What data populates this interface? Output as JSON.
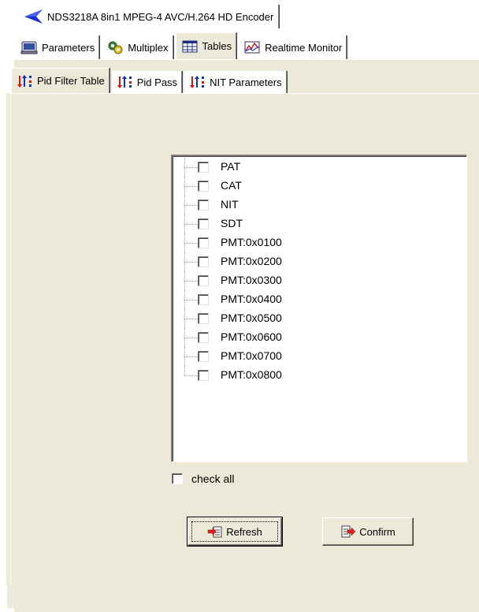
{
  "device_title": "NDS3218A 8in1 MPEG-4 AVC/H.264 HD Encoder",
  "main_tabs": [
    {
      "label": "Parameters",
      "icon": "parameters-icon"
    },
    {
      "label": "Multiplex",
      "icon": "multiplex-icon"
    },
    {
      "label": "Tables",
      "icon": "tables-icon",
      "active": true
    },
    {
      "label": "Realtime Monitor",
      "icon": "realtime-monitor-icon"
    }
  ],
  "sub_tabs": [
    {
      "label": "Pid Filter Table",
      "icon": "pid-icon",
      "active": true
    },
    {
      "label": "Pid Pass",
      "icon": "pid-icon"
    },
    {
      "label": "NIT Parameters",
      "icon": "pid-icon"
    }
  ],
  "pid_list": [
    {
      "label": "PAT",
      "checked": false
    },
    {
      "label": "CAT",
      "checked": false
    },
    {
      "label": "NIT",
      "checked": false
    },
    {
      "label": "SDT",
      "checked": false
    },
    {
      "label": "PMT:0x0100",
      "checked": false
    },
    {
      "label": "PMT:0x0200",
      "checked": false
    },
    {
      "label": "PMT:0x0300",
      "checked": false
    },
    {
      "label": "PMT:0x0400",
      "checked": false
    },
    {
      "label": "PMT:0x0500",
      "checked": false
    },
    {
      "label": "PMT:0x0600",
      "checked": false
    },
    {
      "label": "PMT:0x0700",
      "checked": false
    },
    {
      "label": "PMT:0x0800",
      "checked": false
    }
  ],
  "check_all": {
    "label": "check all",
    "checked": false
  },
  "buttons": {
    "refresh_label": "Refresh",
    "confirm_label": "Confirm"
  },
  "colors": {
    "panel_bg": "#ece9d8",
    "arrow_blue": "#1a2fd6",
    "pid_red": "#e01010",
    "pid_blue": "#1030c0"
  }
}
